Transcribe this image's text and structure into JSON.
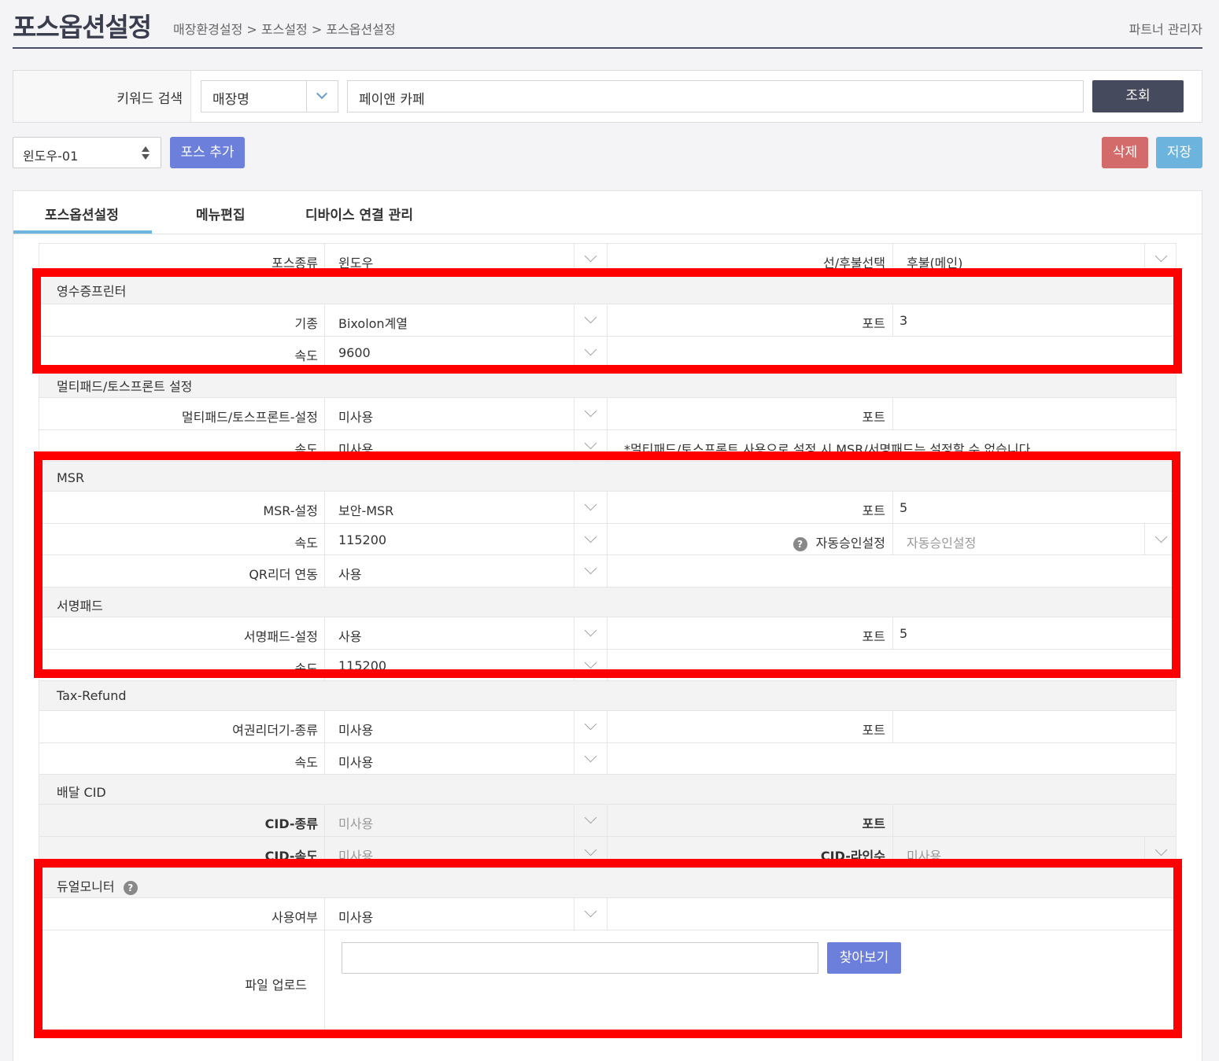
{
  "header": {
    "title": "포스옵션설정",
    "breadcrumb": "매장환경설정 > 포스설정 > 포스옵션설정",
    "user_role": "파트너 관리자"
  },
  "search": {
    "label": "키워드 검색",
    "type_value": "매장명",
    "keyword_value": "페이앤 카페",
    "button": "조회"
  },
  "toolbar": {
    "pos_select_value": "윈도우-01",
    "add_button": "포스 추가",
    "delete_button": "삭제",
    "save_button": "저장"
  },
  "tabs": [
    "포스옵션설정",
    "메뉴편집",
    "디바이스 연결 관리"
  ],
  "top_row": {
    "pos_type_label": "포스종류",
    "pos_type_value": "윈도우",
    "pay_type_label": "선/후불선택",
    "pay_type_value": "후불(메인)"
  },
  "receipt_printer": {
    "title": "영수증프린터",
    "model_label": "기종",
    "model_value": "Bixolon계열",
    "port_label": "포트",
    "port_value": "3",
    "speed_label": "속도",
    "speed_value": "9600"
  },
  "multipad": {
    "title": "멀티패드/토스프론트 설정",
    "setting_label": "멀티패드/토스프론트-설정",
    "setting_value": "미사용",
    "port_label": "포트",
    "port_value": "",
    "speed_label": "속도",
    "speed_value": "미사용",
    "notice": "*멀티패드/토스프론트 사용으로 설정 시 MSR/서명패드는 설정할 수 없습니다."
  },
  "msr": {
    "title": "MSR",
    "setting_label": "MSR-설정",
    "setting_value": "보안-MSR",
    "port_label": "포트",
    "port_value": "5",
    "speed_label": "속도",
    "speed_value": "115200",
    "auto_approve_label": "자동승인설정",
    "auto_approve_value": "자동승인설정",
    "qr_label": "QR리더 연동",
    "qr_value": "사용"
  },
  "sign_pad": {
    "title": "서명패드",
    "setting_label": "서명패드-설정",
    "setting_value": "사용",
    "port_label": "포트",
    "port_value": "5",
    "speed_label": "속도",
    "speed_value": "115200"
  },
  "tax_refund": {
    "title": "Tax-Refund",
    "reader_label": "여권리더기-종류",
    "reader_value": "미사용",
    "port_label": "포트",
    "port_value": "",
    "speed_label": "속도",
    "speed_value": "미사용"
  },
  "delivery_cid": {
    "title": "배달 CID",
    "type_label": "CID-종류",
    "type_value": "미사용",
    "port_label": "포트",
    "port_value": "",
    "speed_label": "CID-속도",
    "speed_value": "미사용",
    "lines_label": "CID-라인수",
    "lines_value": "미사용"
  },
  "dual_monitor": {
    "title": "듀얼모니터",
    "use_label": "사용여부",
    "use_value": "미사용",
    "upload_label": "파일 업로드",
    "browse_button": "찾아보기",
    "help_icon": "?"
  },
  "colors": {
    "highlight": "#ff0000",
    "primary_button": "#6b7fdb",
    "search_button": "#454a5c",
    "delete_button": "#d46b6b",
    "save_button": "#6cb3dd"
  }
}
